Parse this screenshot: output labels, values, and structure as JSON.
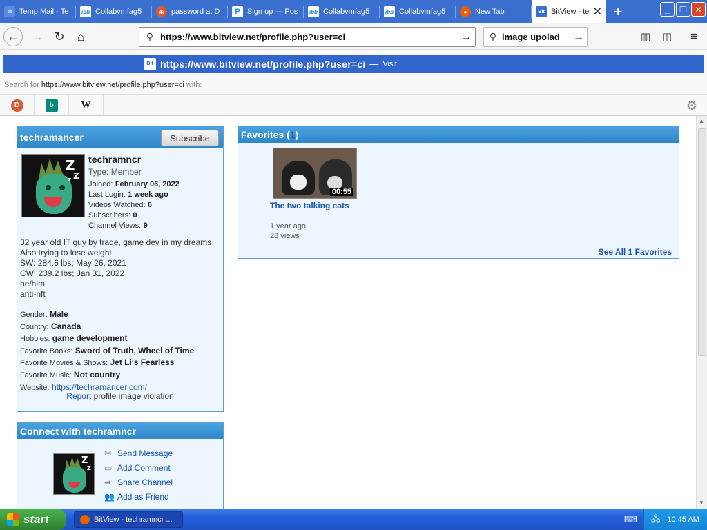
{
  "tabs": [
    {
      "label": "Temp Mail - Te",
      "icon": "mail-icon",
      "color": "#3a6fd0"
    },
    {
      "label": "Collabvmfag5",
      "icon": "ibb-icon",
      "color": "#1e88e5"
    },
    {
      "label": "password at D",
      "icon": "duckduckgo-icon",
      "color": "#de5833"
    },
    {
      "label": "Sign up — Pos",
      "icon": "p-icon",
      "color": "#1e88e5"
    },
    {
      "label": "Collabvmfag5",
      "icon": "ibb-icon",
      "color": "#1e88e5"
    },
    {
      "label": "Collabvmfag5",
      "icon": "ibb-icon",
      "color": "#1e88e5"
    },
    {
      "label": "New Tab",
      "icon": "firefox-icon",
      "color": "#e66000"
    },
    {
      "label": "BitView - te",
      "icon": "bitview-icon",
      "color": "#3a6fd0"
    }
  ],
  "urlbar": {
    "value": "https://www.bitview.net/profile.php?user=ci"
  },
  "searchbar": {
    "value": "image upolad"
  },
  "suggest": {
    "url": "https://www.bitview.net/profile.php?user=ci",
    "dash": "—",
    "visit": "Visit",
    "search_prefix": "Search for",
    "search_query": "https://www.bitview.net/profile.php?user=ci",
    "search_suffix": "with:"
  },
  "profile": {
    "header_name": "techramancer",
    "subscribe_label": "Subscribe",
    "username": "techramncr",
    "type_label": "Type:",
    "type_value": "Member",
    "joined_label": "Joined:",
    "joined_value": "February 06, 2022",
    "lastlogin_label": "Last Login:",
    "lastlogin_value": "1 week ago",
    "videos_label": "Videos Watched:",
    "videos_value": "6",
    "subs_label": "Subscribers:",
    "subs_value": "0",
    "views_label": "Channel Views:",
    "views_value": "9",
    "bio": [
      "32 year old IT guy by trade, game dev in my dreams",
      "Also trying to lose weight",
      "SW: 284.6 lbs; May 26, 2021",
      "CW: 239.2 lbs; Jan 31, 2022",
      "he/him",
      "anti-nft"
    ],
    "gender_label": "Gender:",
    "gender_value": "Male",
    "country_label": "Country:",
    "country_value": "Canada",
    "hobbies_label": "Hobbies:",
    "hobbies_value": "game development",
    "books_label": "Favorite Books:",
    "books_value": "Sword of Truth, Wheel of Time",
    "movies_label": "Favorite Movies & Shows:",
    "movies_value": "Jet Li's Fearless",
    "music_label": "Favorite Music:",
    "music_value": "Not country",
    "website_label": "Website:",
    "website_value": "https://techramancer.com/",
    "report_link": "Report",
    "report_text": "profile image violation"
  },
  "connect": {
    "header": "Connect with techramncr",
    "send_message": "Send Message",
    "add_comment": "Add Comment",
    "share_channel": "Share Channel",
    "add_friend": "Add as Friend"
  },
  "favorites": {
    "header_label": "Favorites (",
    "count": "1",
    "header_close": ")",
    "video_title": "The two talking cats",
    "duration": "00:55",
    "age": "1 year ago",
    "views": "28 views",
    "see_all_prefix": "See All",
    "see_all_count": "1",
    "see_all_suffix": "Favorites"
  },
  "taskbar": {
    "start_label": "start",
    "task_label": "BitView - techramncr ...",
    "clock": "10:45 AM"
  },
  "colors": {
    "tabbar": "#3a6fd0",
    "suggest_highlight": "#3366cc",
    "box_header": "#3a8fd0",
    "box_bg": "#eef6fd",
    "taskbar": "#245edb",
    "start": "#3c9a3c"
  }
}
